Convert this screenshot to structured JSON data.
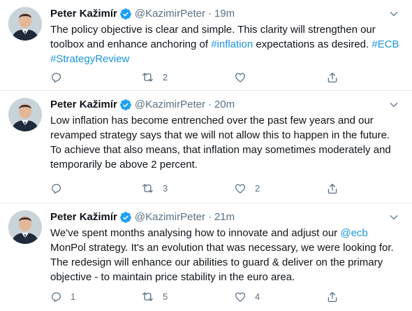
{
  "tweets": [
    {
      "author": {
        "name": "Peter Kažimír",
        "handle": "@KazimirPeter",
        "verified": true
      },
      "time": "19m",
      "text_parts": [
        "The policy objective is clear and simple. This clarity will strengthen our toolbox and enhance anchoring of ",
        "#inflation",
        " expectations as desired. ",
        "#ECB",
        " ",
        "#StrategyReview"
      ],
      "counts": {
        "reply": "",
        "retweet": "2",
        "like": "",
        "share": ""
      }
    },
    {
      "author": {
        "name": "Peter Kažimír",
        "handle": "@KazimirPeter",
        "verified": true
      },
      "time": "20m",
      "text_parts": [
        "Low inflation has become entrenched over the past few years and our revamped strategy says that we will not allow this to happen in the future. To achieve that also means, that inflation may sometimes moderately and temporarily be above 2 percent."
      ],
      "counts": {
        "reply": "",
        "retweet": "3",
        "like": "2",
        "share": ""
      }
    },
    {
      "author": {
        "name": "Peter Kažimír",
        "handle": "@KazimirPeter",
        "verified": true
      },
      "time": "21m",
      "text_parts": [
        "We've spent months analysing how to innovate and adjust our ",
        "@ecb",
        " MonPol strategy. It's an evolution that was necessary, we were looking for. The redesign will enhance our abilities to guard & deliver on the primary objective - to maintain price stability in the euro area."
      ],
      "counts": {
        "reply": "1",
        "retweet": "5",
        "like": "4",
        "share": ""
      }
    }
  ],
  "header_separator": "·",
  "colors": {
    "link": "#1b95e0",
    "verified": "#1da1f2",
    "muted": "#5b7083",
    "text": "#0f1419",
    "divider": "#e6ecf0"
  },
  "icons": {
    "verified": "verified-badge-icon",
    "caret": "chevron-down-icon",
    "reply": "reply-icon",
    "retweet": "retweet-icon",
    "like": "heart-icon",
    "share": "share-icon"
  }
}
